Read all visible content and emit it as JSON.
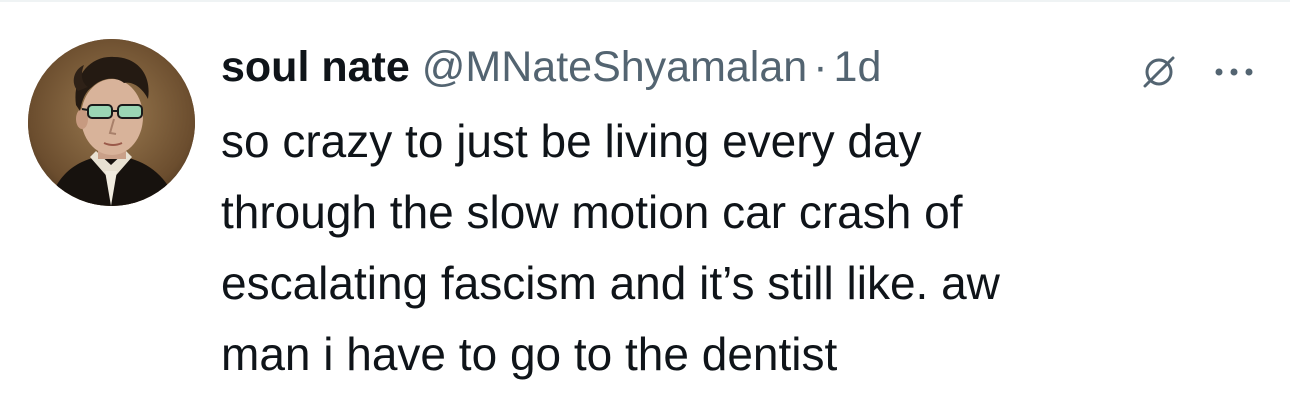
{
  "tweet": {
    "author": {
      "display_name": "soul nate",
      "handle": "@MNateShyamalan",
      "avatar_icon": "profile-avatar-painted-portrait-sunglasses"
    },
    "separator": "·",
    "time": "1d",
    "text_lines": [
      "so crazy to just be living every day",
      "through the slow motion car crash of",
      "escalating fascism and it’s still like. aw",
      "man i have to go to the dentist"
    ],
    "actions": {
      "grok_icon": "grok-slash-circle-icon",
      "more_icon": "more-dots-icon"
    }
  },
  "colors": {
    "text_primary": "#0f1419",
    "text_secondary": "#536471",
    "divider": "#eff3f4",
    "background": "#ffffff"
  }
}
